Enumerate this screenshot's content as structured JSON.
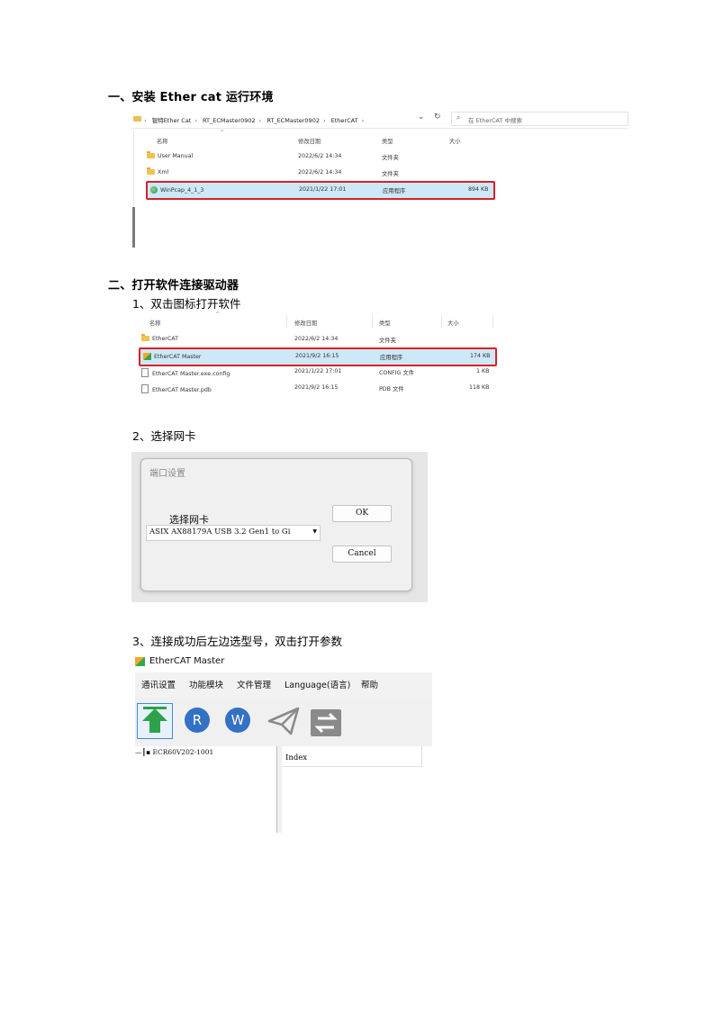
{
  "section1": {
    "heading": "一、安装 Ether cat 运行环境"
  },
  "explorer1": {
    "breadcrumbs": [
      "锟特Ether Cat",
      "RT_ECMaster0902",
      "RT_ECMaster0902",
      "EtherCAT"
    ],
    "breadcrumb_prefix": "›",
    "search_placeholder": "在 EtherCAT 中搜索",
    "columns": {
      "name": "名称",
      "date": "修改日期",
      "type": "类型",
      "size": "大小"
    },
    "rows": [
      {
        "icon": "folder-icon",
        "name": "User Manual",
        "date": "2022/6/2 14:34",
        "type": "文件夹",
        "size": ""
      },
      {
        "icon": "folder-icon",
        "name": "Xml",
        "date": "2022/6/2 14:34",
        "type": "文件夹",
        "size": ""
      },
      {
        "icon": "winpcap-app-icon",
        "name": "WinPcap_4_1_3",
        "date": "2021/1/22 17:01",
        "type": "应用程序",
        "size": "894 KB",
        "selected": true
      }
    ]
  },
  "section2": {
    "heading": "二、打开软件连接驱动器",
    "step1": "1、双击图标打开软件",
    "step2": "2、选择网卡",
    "step3": "3、连接成功后左边选型号，双击打开参数"
  },
  "explorer2": {
    "columns": {
      "name": "名称",
      "date": "修改日期",
      "type": "类型",
      "size": "大小"
    },
    "rows": [
      {
        "icon": "folder-icon",
        "name": "EtherCAT",
        "date": "2022/6/2 14:34",
        "type": "文件夹",
        "size": ""
      },
      {
        "icon": "ethercat-app-icon",
        "name": "EtherCAT Master",
        "date": "2021/9/2 16:15",
        "type": "应用程序",
        "size": "174 KB",
        "selected": true
      },
      {
        "icon": "file-icon",
        "name": "EtherCAT Master.exe.config",
        "date": "2021/1/22 17:01",
        "type": "CONFIG 文件",
        "size": "1 KB"
      },
      {
        "icon": "file-icon",
        "name": "EtherCAT Master.pdb",
        "date": "2021/9/2 16:15",
        "type": "PDB 文件",
        "size": "118 KB"
      }
    ]
  },
  "dialog": {
    "title": "端口设置",
    "label": "选择网卡",
    "selected_adapter": "ASIX AX88179A USB 3.2 Gen1 to Gi",
    "ok_label": "OK",
    "cancel_label": "Cancel"
  },
  "app": {
    "title": "EtherCAT Master",
    "menus": [
      "通讯设置",
      "功能模块",
      "文件管理",
      "Language(语言)",
      "帮助"
    ],
    "toolbar_icons": [
      "upload-arrow-icon",
      "read-icon",
      "write-icon",
      "send-icon",
      "swap-icon"
    ],
    "read_letter": "R",
    "write_letter": "W",
    "tree_node": "ECR60V202-1001",
    "grid_header": "Index"
  },
  "colors": {
    "selection_border": "#d8202a",
    "selection_fill": "#cde8f7",
    "accent_blue": "#3371c4",
    "green": "#2ea24a"
  }
}
